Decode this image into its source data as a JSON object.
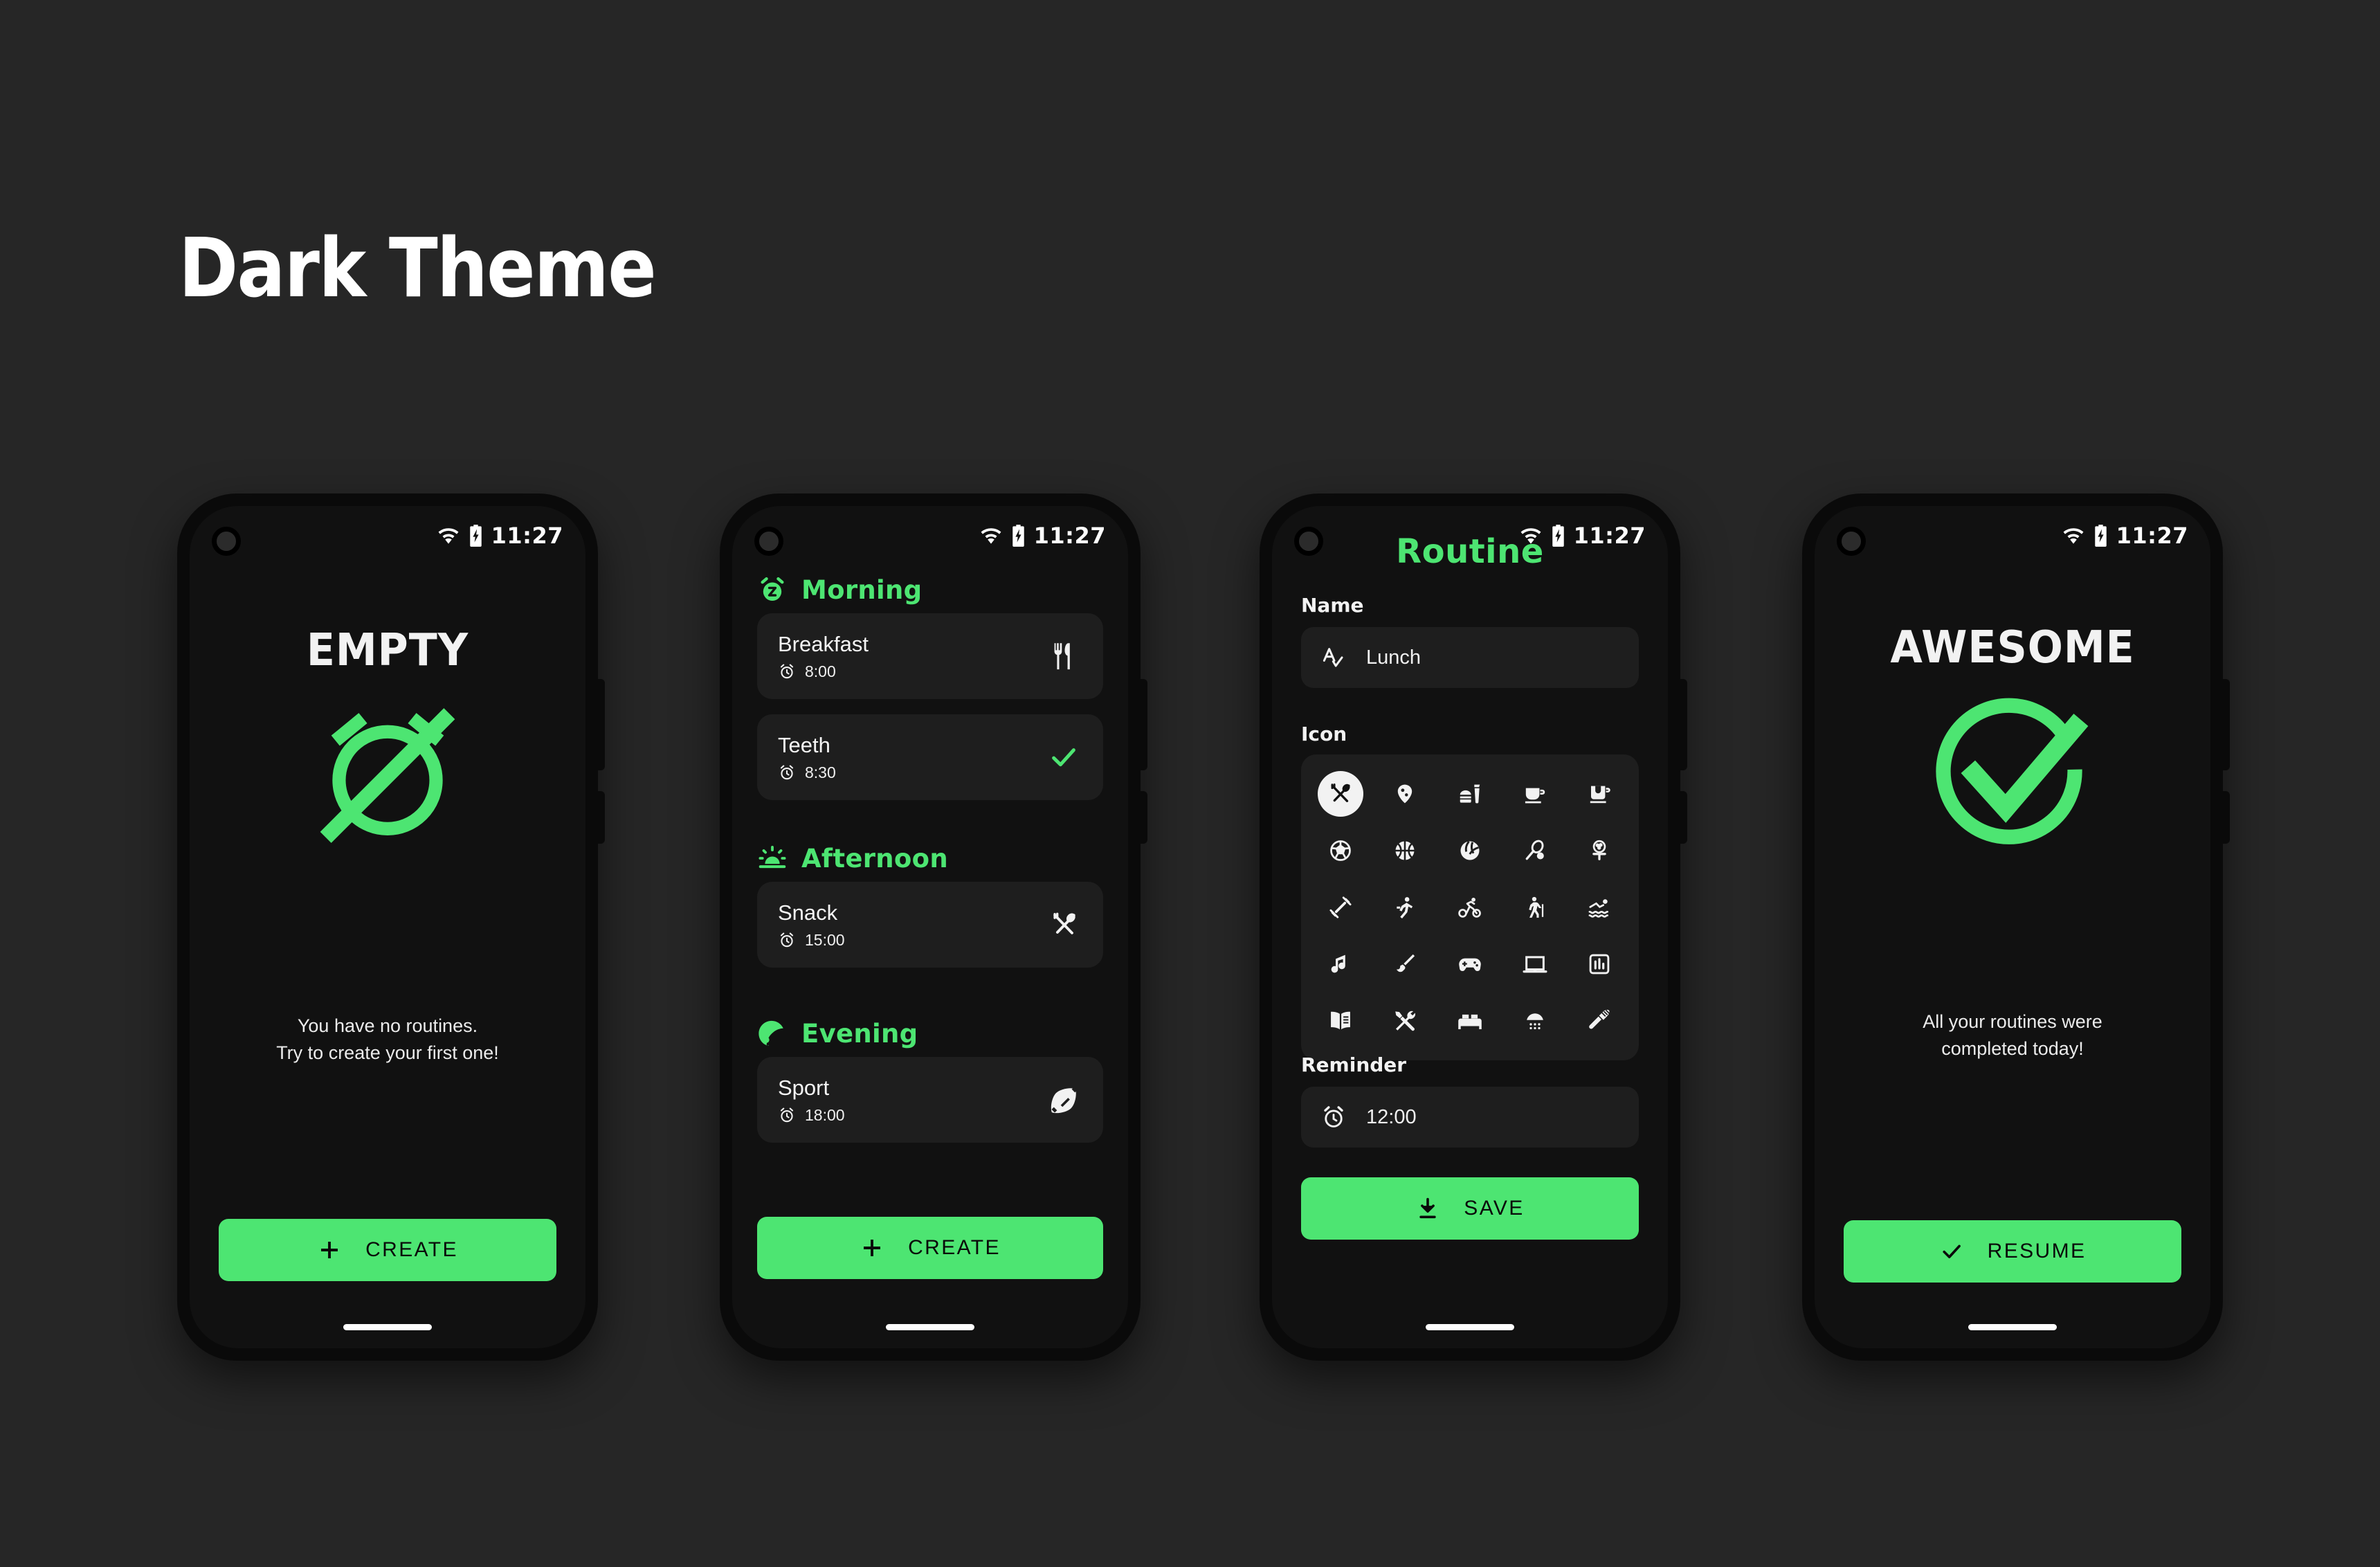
{
  "page": {
    "title": "Dark Theme",
    "background_color": "#262626",
    "accent_color": "#4de572",
    "surface_color": "#1e1e1e",
    "screen_color": "#111111",
    "frame_color": "#0a0a0a"
  },
  "status_bar": {
    "time": "11:27",
    "wifi_icon": "wifi-icon",
    "battery_icon": "battery-charging-icon"
  },
  "phones": [
    {
      "id": "phone-empty",
      "screen_name": "empty-state",
      "headline": "EMPTY",
      "hero_icon": "alarm-off-icon",
      "message_line1": "You have no routines.",
      "message_line2": "Try to create your first one!",
      "cta": {
        "label": "CREATE",
        "icon": "plus-icon"
      }
    },
    {
      "id": "phone-routines",
      "screen_name": "routine-list",
      "sections": [
        {
          "title": "Morning",
          "icon": "alarm-snooze-icon",
          "items": [
            {
              "name": "Breakfast",
              "time": "8:00",
              "time_icon": "alarm-clock-icon",
              "trailing_icon": "fork-knife-icon",
              "done": false
            },
            {
              "name": "Teeth",
              "time": "8:30",
              "time_icon": "alarm-clock-icon",
              "trailing_icon": "check-icon",
              "done": true
            }
          ]
        },
        {
          "title": "Afternoon",
          "icon": "sunrise-icon",
          "items": [
            {
              "name": "Snack",
              "time": "15:00",
              "time_icon": "alarm-clock-icon",
              "trailing_icon": "fork-spoon-crossed-icon",
              "done": false
            }
          ]
        },
        {
          "title": "Evening",
          "icon": "moon-icon",
          "items": [
            {
              "name": "Sport",
              "time": "18:00",
              "time_icon": "alarm-clock-icon",
              "trailing_icon": "football-icon",
              "done": false
            }
          ]
        }
      ],
      "cta": {
        "label": "CREATE",
        "icon": "plus-icon"
      }
    },
    {
      "id": "phone-form",
      "screen_name": "routine-editor",
      "title": "Routine",
      "name_field": {
        "label": "Name",
        "value": "Lunch",
        "icon": "text-check-icon",
        "placeholder": "Name"
      },
      "icon_field": {
        "label": "Icon",
        "selected_index": 0,
        "options": [
          "fork-spoon-crossed-icon",
          "pizza-icon",
          "fast-food-icon",
          "coffee-cup-icon",
          "tea-cup-icon",
          "soccer-ball-icon",
          "basketball-icon",
          "volleyball-icon",
          "tennis-racket-icon",
          "golf-tee-icon",
          "dumbbell-icon",
          "running-icon",
          "cycling-icon",
          "hiking-icon",
          "swimming-icon",
          "music-note-icon",
          "paint-brush-icon",
          "gamepad-icon",
          "laptop-icon",
          "chart-box-icon",
          "open-book-icon",
          "tools-icon",
          "bed-icon",
          "shower-icon",
          "toothbrush-icon"
        ]
      },
      "reminder_field": {
        "label": "Reminder",
        "value": "12:00",
        "icon": "alarm-clock-icon"
      },
      "cta": {
        "label": "SAVE",
        "icon": "download-icon"
      }
    },
    {
      "id": "phone-done",
      "screen_name": "all-done-state",
      "headline": "AWESOME",
      "hero_icon": "check-circle-icon",
      "message_line1": "All your routines were",
      "message_line2": "completed today!",
      "cta": {
        "label": "RESUME",
        "icon": "check-icon"
      }
    }
  ]
}
